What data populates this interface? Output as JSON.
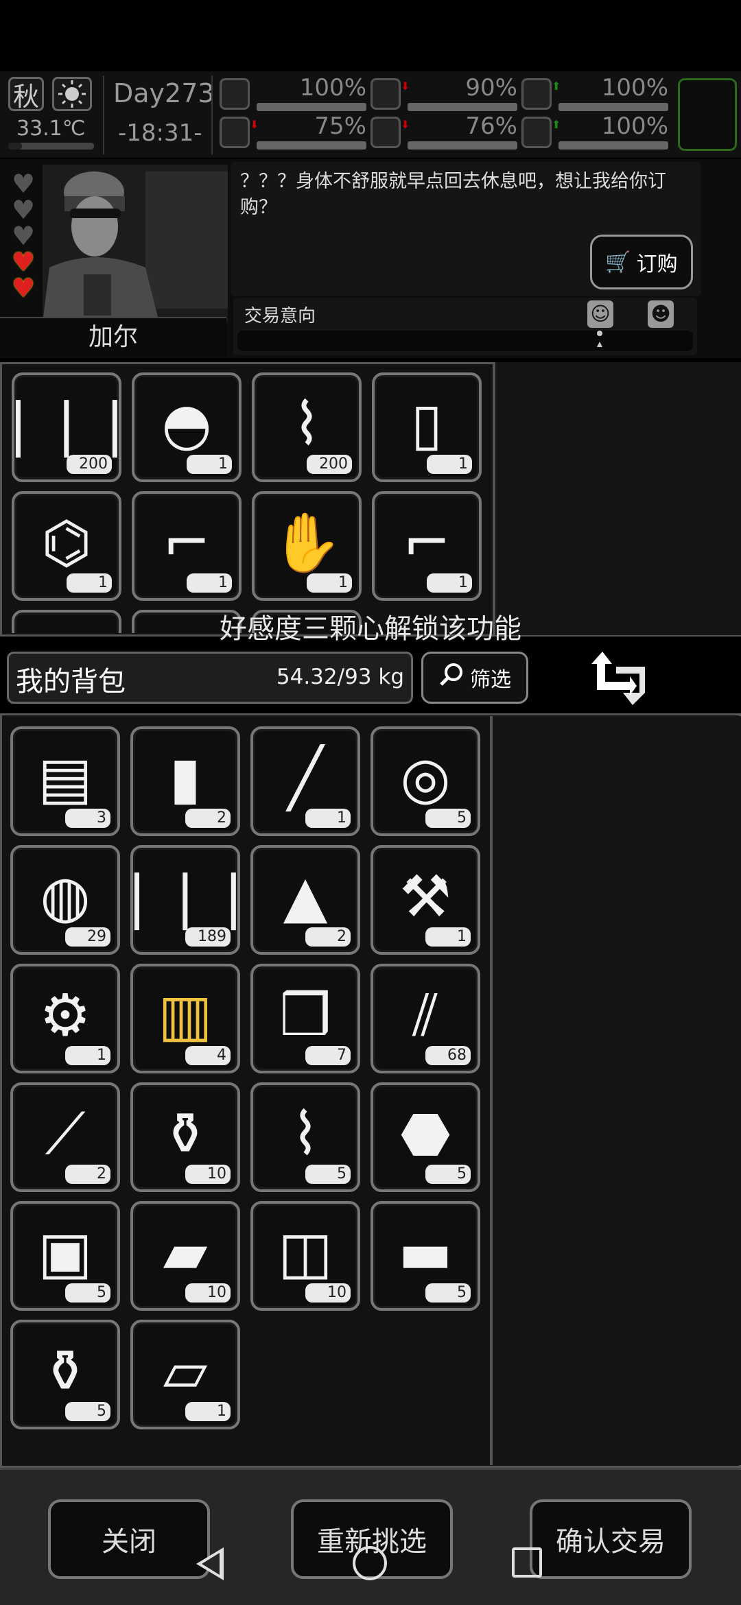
{
  "status": {
    "season": "秋",
    "weather_icon": "sun-icon",
    "temperature": "33.1℃",
    "day": "Day273",
    "time": "-18:31-",
    "stats": [
      {
        "name": "health",
        "icon": "medkit-icon",
        "value": "100%",
        "trend": "none"
      },
      {
        "name": "stomach",
        "icon": "stomach-icon",
        "value": "90%",
        "trend": "down"
      },
      {
        "name": "medicine",
        "icon": "pill-icon",
        "value": "100%",
        "trend": "up"
      },
      {
        "name": "stamina",
        "icon": "boot-icon",
        "value": "75%",
        "trend": "down"
      },
      {
        "name": "water",
        "icon": "water-drop-icon",
        "value": "76%",
        "trend": "down"
      },
      {
        "name": "mood",
        "icon": "heart-icon",
        "value": "100%",
        "trend": "up"
      }
    ]
  },
  "npc": {
    "name": "加尔",
    "affection_hearts": {
      "total": 5,
      "filled": 2
    },
    "dialog": "？？？身体不舒服就早点回去休息吧，想让我给你订购？",
    "order_label": "订购",
    "trade_intent_label": "交易意向",
    "trade_intent_level": 0.54
  },
  "trader_items": [
    {
      "icon": "bullets-icon",
      "glyph": "❘❘❘",
      "qty": "200"
    },
    {
      "icon": "helmet-icon",
      "glyph": "◓",
      "qty": "1"
    },
    {
      "icon": "glue-icon",
      "glyph": "⌇",
      "qty": "200"
    },
    {
      "icon": "paper-icon",
      "glyph": "▯",
      "qty": "1"
    },
    {
      "icon": "folding-chair-icon",
      "glyph": "⌬",
      "qty": "1"
    },
    {
      "icon": "rifle-icon",
      "glyph": "⌐",
      "qty": "1"
    },
    {
      "icon": "glove-icon",
      "glyph": "✋",
      "qty": "1"
    },
    {
      "icon": "pistol-icon",
      "glyph": "⌐",
      "qty": "1"
    }
  ],
  "lock_message": "好感度三颗心解锁该功能",
  "backpack": {
    "title": "我的背包",
    "weight": "54.32/93 kg",
    "filter_label": "筛选",
    "items": [
      {
        "icon": "towel-icon",
        "glyph": "▤",
        "qty": "3"
      },
      {
        "icon": "water-bottle-icon",
        "glyph": "▮",
        "qty": "2"
      },
      {
        "icon": "shovel-icon",
        "glyph": "╱",
        "qty": "1"
      },
      {
        "icon": "rope-icon",
        "glyph": "◎",
        "qty": "5"
      },
      {
        "icon": "net-icon",
        "glyph": "◍",
        "qty": "29"
      },
      {
        "icon": "bullets-icon",
        "glyph": "❘❘❘",
        "qty": "189"
      },
      {
        "icon": "raw-meat-icon",
        "glyph": "▲",
        "qty": "2"
      },
      {
        "icon": "axe-icon",
        "glyph": "⚒",
        "qty": "1"
      },
      {
        "icon": "toolbox-icon",
        "glyph": "⚙",
        "qty": "1"
      },
      {
        "icon": "juice-glass-icon",
        "glyph": "▥",
        "qty": "4"
      },
      {
        "icon": "ice-cubes-icon",
        "glyph": "❒",
        "qty": "7"
      },
      {
        "icon": "rifle-rounds-icon",
        "glyph": "⫽",
        "qty": "68"
      },
      {
        "icon": "test-tube-icon",
        "glyph": "⟋",
        "qty": "2"
      },
      {
        "icon": "spray-cans-icon",
        "glyph": "⚱",
        "qty": "10"
      },
      {
        "icon": "scroll-icon",
        "glyph": "⌇",
        "qty": "5"
      },
      {
        "icon": "grenade-icon",
        "glyph": "⬣",
        "qty": "5"
      },
      {
        "icon": "seed-packet-icon",
        "glyph": "▣",
        "qty": "5"
      },
      {
        "icon": "bread-icon",
        "glyph": "▰",
        "qty": "10"
      },
      {
        "icon": "canned-food-icon",
        "glyph": "◫",
        "qty": "10"
      },
      {
        "icon": "gold-bars-icon",
        "glyph": "▬",
        "qty": "5"
      },
      {
        "icon": "vase-icon",
        "glyph": "⚱",
        "qty": "5"
      },
      {
        "icon": "oxygen-tank-icon",
        "glyph": "⏥",
        "qty": "1"
      }
    ]
  },
  "buttons": {
    "close": "关闭",
    "reselect": "重新挑选",
    "confirm": "确认交易"
  },
  "colors": {
    "highlight": "#f0c040",
    "heart_full": "#e02020",
    "trend_up": "#1a8a1a",
    "trend_down": "#c00000"
  }
}
